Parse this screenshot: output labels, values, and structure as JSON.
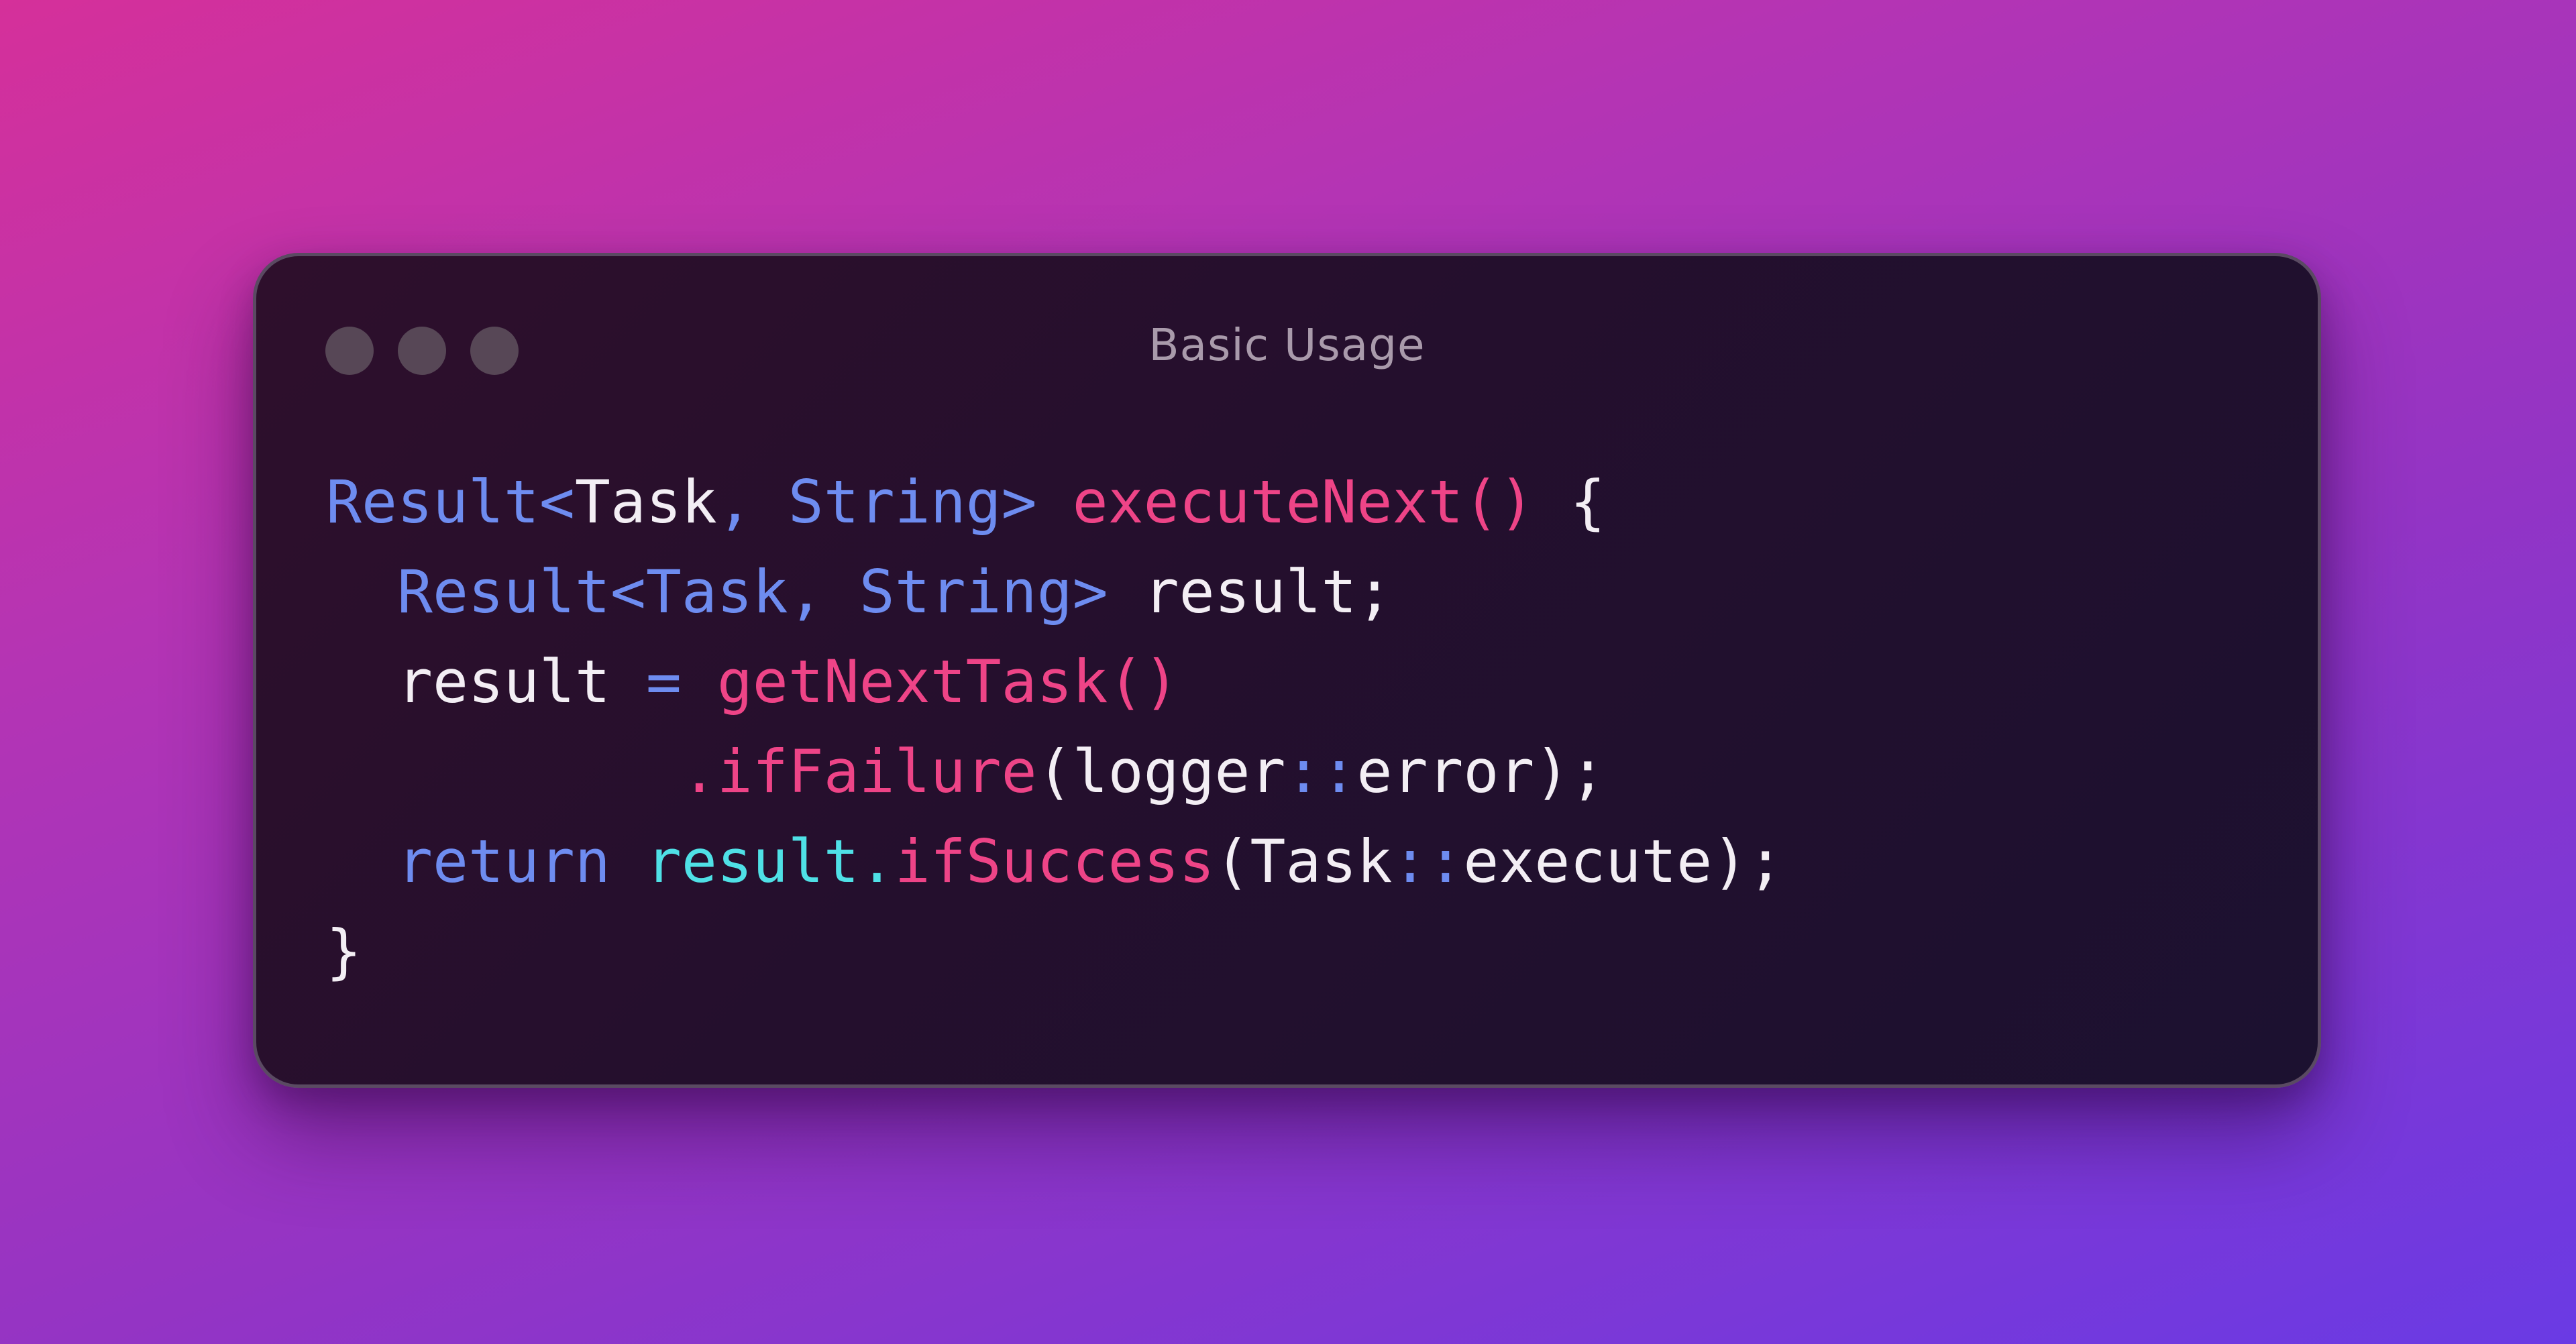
{
  "window": {
    "title": "Basic Usage",
    "controls": [
      "close-dot",
      "minimize-dot",
      "maximize-dot"
    ]
  },
  "code": {
    "language": "java",
    "lines": [
      "Result<Task, String> executeNext() {",
      "  Result<Task, String> result;",
      "  result = getNextTask()",
      "          .ifFailure(logger::error);",
      "  return result.ifSuccess(Task::execute);",
      "}"
    ]
  },
  "colors": {
    "background_start": "#d5309a",
    "background_end": "#6a3ae4",
    "window_bg": "#240f2d",
    "type": "#6e8cf0",
    "function": "#ee4487",
    "identifier": "#f3eef4",
    "member": "#4fe0e6",
    "title": "#a99aab"
  }
}
